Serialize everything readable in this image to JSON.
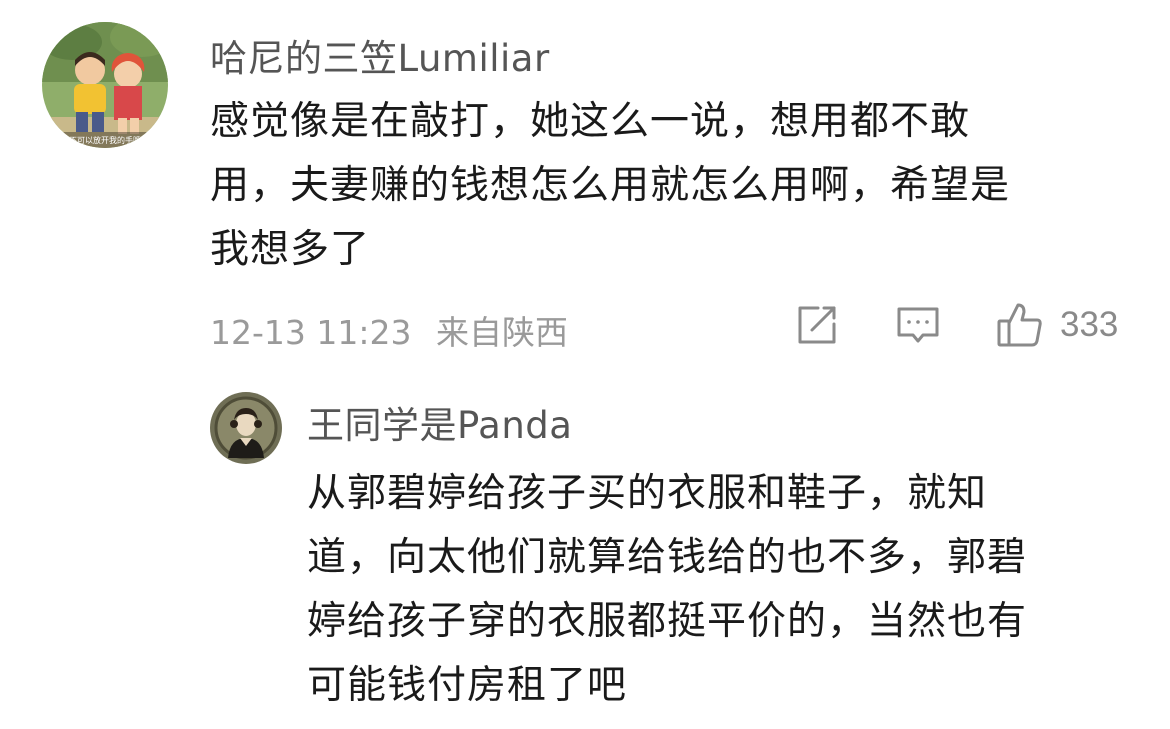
{
  "comment": {
    "username": "哈尼的三笠Lumiliar",
    "text_lines": [
      "感觉像是在敲打，她这么一说，想用都不敢",
      "用，夫妻赚的钱想怎么用就怎么用啊，希望是",
      "我想多了"
    ],
    "timestamp": "12-13 11:23",
    "location": "来自陕西",
    "like_count": "333",
    "avatar_caption": "不可以放开我的手哦",
    "icons": {
      "share": "share-edit-icon",
      "reply": "comment-bubble-icon",
      "like": "thumbs-up-icon"
    }
  },
  "reply": {
    "username": "王同学是Panda",
    "text_lines": [
      "从郭碧婷给孩子买的衣服和鞋子，就知",
      "道，向太他们就算给钱给的也不多，郭碧",
      "婷给孩子穿的衣服都挺平价的，当然也有",
      "可能钱付房租了吧"
    ]
  },
  "colors": {
    "text": "#1a1a1a",
    "username": "#555555",
    "meta": "#9a9a9a",
    "icon": "#8a8a8a"
  }
}
